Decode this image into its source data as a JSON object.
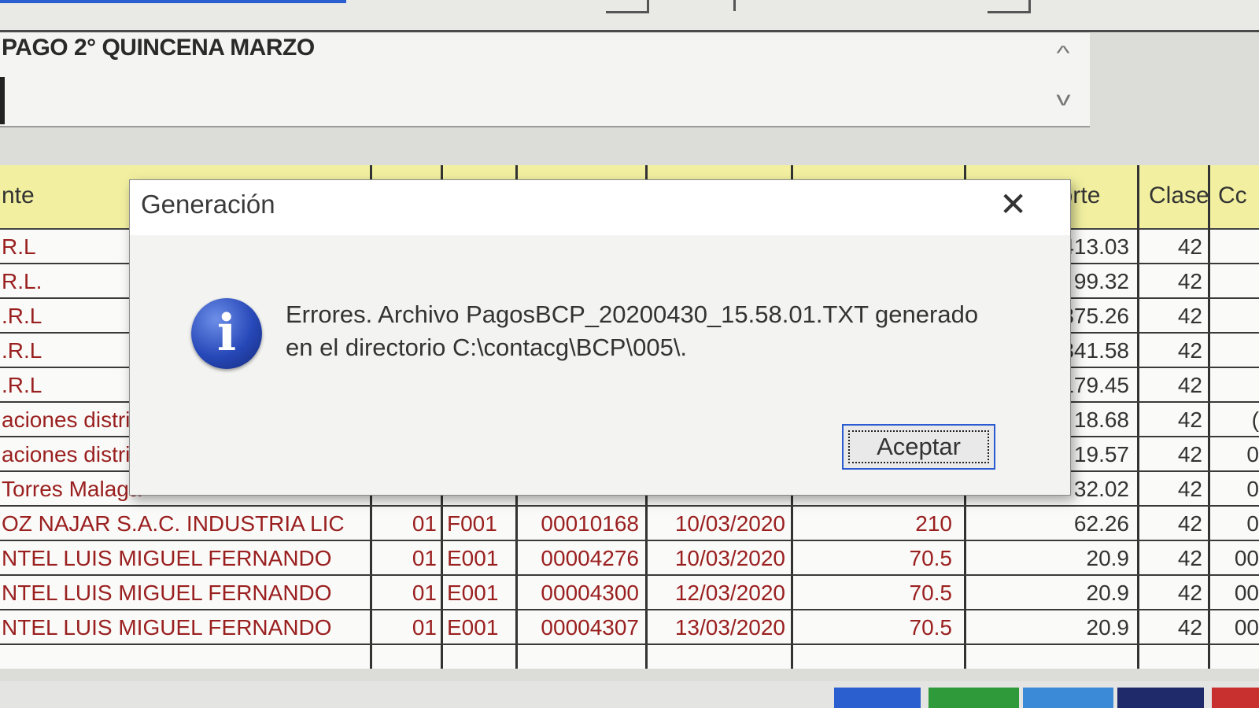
{
  "memo": {
    "text": "PAGO 2° QUINCENA MARZO"
  },
  "grid": {
    "header_left": "nte",
    "header_importe": "porte",
    "header_clase": "Clase",
    "header_extra": "Cc",
    "rows": [
      {
        "name": "R.L",
        "importe": "413.03",
        "clase": "42",
        "extra": ""
      },
      {
        "name": "R.L.",
        "importe": "99.32",
        "clase": "42",
        "extra": ""
      },
      {
        "name": ".R.L",
        "importe": "375.26",
        "clase": "42",
        "extra": ""
      },
      {
        "name": ".R.L",
        "importe": "341.58",
        "clase": "42",
        "extra": ""
      },
      {
        "name": ".R.L",
        "importe": "179.45",
        "clase": "42",
        "extra": ""
      },
      {
        "name": "aciones distri",
        "importe": "18.68",
        "clase": "42",
        "extra": "("
      },
      {
        "name": "aciones distri",
        "importe": "19.57",
        "clase": "42",
        "extra": "0"
      },
      {
        "name": "Torres Malaga",
        "importe": "32.02",
        "clase": "42",
        "extra": "0"
      },
      {
        "name": "OZ NAJAR S.A.C. INDUSTRIA LIC",
        "tipo": "01",
        "serie": "F001",
        "numero": "00010168",
        "fecha": "10/03/2020",
        "monto": "210",
        "importe": "62.26",
        "clase": "42",
        "extra": "0"
      },
      {
        "name": "NTEL LUIS MIGUEL FERNANDO",
        "tipo": "01",
        "serie": "E001",
        "numero": "00004276",
        "fecha": "10/03/2020",
        "monto": "70.5",
        "importe": "20.9",
        "clase": "42",
        "extra": "00"
      },
      {
        "name": "NTEL LUIS MIGUEL FERNANDO",
        "tipo": "01",
        "serie": "E001",
        "numero": "00004300",
        "fecha": "12/03/2020",
        "monto": "70.5",
        "importe": "20.9",
        "clase": "42",
        "extra": "00"
      },
      {
        "name": "NTEL LUIS MIGUEL FERNANDO",
        "tipo": "01",
        "serie": "E001",
        "numero": "00004307",
        "fecha": "13/03/2020",
        "monto": "70.5",
        "importe": "20.9",
        "clase": "42",
        "extra": "00"
      }
    ]
  },
  "dialog": {
    "title": "Generación",
    "close_glyph": "✕",
    "icon": "info-icon",
    "icon_glyph": "i",
    "message": "Errores. Archivo PagosBCP_20200430_15.58.01.TXT generado en el directorio C:\\contacg\\BCP\\005\\.",
    "ok_label": "Aceptar"
  },
  "colors": {
    "header_yellow": "#f2f0a0",
    "row_text_red": "#9a2020",
    "focus_blue": "#2a5bd0"
  }
}
